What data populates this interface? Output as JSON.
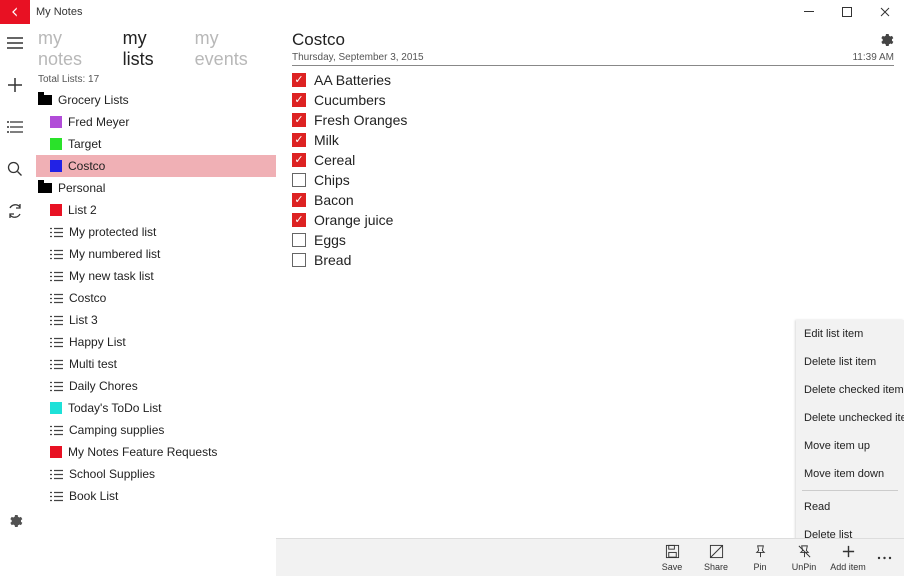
{
  "window": {
    "title": "My Notes"
  },
  "tabs": {
    "notes": "my notes",
    "lists": "my lists",
    "events": "my events"
  },
  "totals": "Total Lists: 17",
  "sidebar": [
    {
      "type": "folder",
      "label": "Grocery Lists"
    },
    {
      "type": "color",
      "color": "#b14cd8",
      "label": "Fred Meyer"
    },
    {
      "type": "color",
      "color": "#2ae22a",
      "label": "Target"
    },
    {
      "type": "color",
      "color": "#2222e6",
      "label": "Costco",
      "selected": true
    },
    {
      "type": "folder",
      "label": "Personal"
    },
    {
      "type": "color",
      "color": "#e81123",
      "label": "List 2"
    },
    {
      "type": "task",
      "label": "My protected list"
    },
    {
      "type": "task",
      "label": "My numbered list"
    },
    {
      "type": "task",
      "label": "My new task list"
    },
    {
      "type": "task",
      "label": "Costco"
    },
    {
      "type": "task",
      "label": "List 3"
    },
    {
      "type": "task",
      "label": "Happy List"
    },
    {
      "type": "task",
      "label": "Multi test"
    },
    {
      "type": "task",
      "label": "Daily Chores"
    },
    {
      "type": "color",
      "color": "#1de1d8",
      "label": "Today's ToDo List"
    },
    {
      "type": "task",
      "label": "Camping supplies"
    },
    {
      "type": "color",
      "color": "#e81123",
      "label": "My Notes Feature Requests"
    },
    {
      "type": "task",
      "label": "School Supplies"
    },
    {
      "type": "task",
      "label": "Book List"
    }
  ],
  "main": {
    "title": "Costco",
    "date": "Thursday, September 3, 2015",
    "time": "11:39 AM"
  },
  "items": [
    {
      "label": "AA Batteries",
      "checked": true
    },
    {
      "label": "Cucumbers",
      "checked": true
    },
    {
      "label": "Fresh Oranges",
      "checked": true
    },
    {
      "label": "Milk",
      "checked": true
    },
    {
      "label": "Cereal",
      "checked": true
    },
    {
      "label": "Chips",
      "checked": false
    },
    {
      "label": "Bacon",
      "checked": true
    },
    {
      "label": "Orange juice",
      "checked": true
    },
    {
      "label": "Eggs",
      "checked": false
    },
    {
      "label": "Bread",
      "checked": false
    }
  ],
  "context": [
    "Edit list item",
    "Delete list item",
    "Delete checked items",
    "Delete unchecked items",
    "Move item up",
    "Move item down",
    "---",
    "Read",
    "Delete list"
  ],
  "bottombar": {
    "save": "Save",
    "share": "Share",
    "pin": "Pin",
    "unpin": "UnPin",
    "additem": "Add item"
  }
}
